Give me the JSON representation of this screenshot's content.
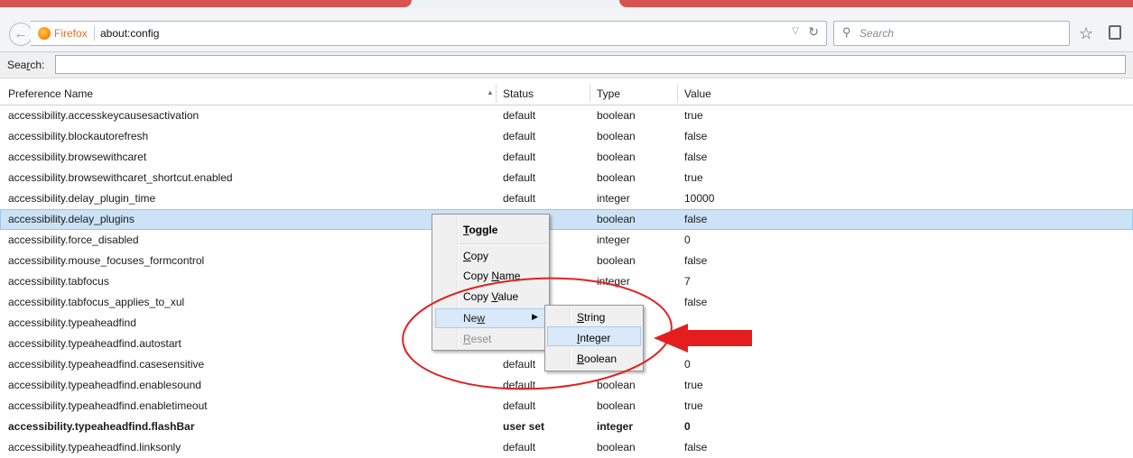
{
  "browser": {
    "identity_label": "Firefox",
    "url": "about:config",
    "search_placeholder": "Search"
  },
  "config": {
    "search_label": "Search:",
    "search_value": ""
  },
  "table": {
    "columns": [
      "Preference Name",
      "Status",
      "Type",
      "Value"
    ],
    "rows": [
      {
        "name": "accessibility.accesskeycausesactivation",
        "status": "default",
        "type": "boolean",
        "value": "true"
      },
      {
        "name": "accessibility.blockautorefresh",
        "status": "default",
        "type": "boolean",
        "value": "false"
      },
      {
        "name": "accessibility.browsewithcaret",
        "status": "default",
        "type": "boolean",
        "value": "false"
      },
      {
        "name": "accessibility.browsewithcaret_shortcut.enabled",
        "status": "default",
        "type": "boolean",
        "value": "true"
      },
      {
        "name": "accessibility.delay_plugin_time",
        "status": "default",
        "type": "integer",
        "value": "10000"
      },
      {
        "name": "accessibility.delay_plugins",
        "status": "",
        "type": "boolean",
        "value": "false",
        "selected": true
      },
      {
        "name": "accessibility.force_disabled",
        "status": "",
        "type": "integer",
        "value": "0"
      },
      {
        "name": "accessibility.mouse_focuses_formcontrol",
        "status": "",
        "type": "boolean",
        "value": "false"
      },
      {
        "name": "accessibility.tabfocus",
        "status": "",
        "type": "integer",
        "value": "7"
      },
      {
        "name": "accessibility.tabfocus_applies_to_xul",
        "status": "",
        "type": "",
        "value": "false"
      },
      {
        "name": "accessibility.typeaheadfind",
        "status": "",
        "type": "",
        "value": ""
      },
      {
        "name": "accessibility.typeaheadfind.autostart",
        "status": "",
        "type": "",
        "value": ""
      },
      {
        "name": "accessibility.typeaheadfind.casesensitive",
        "status": "default",
        "type": "",
        "value": "0"
      },
      {
        "name": "accessibility.typeaheadfind.enablesound",
        "status": "default",
        "type": "boolean",
        "value": "true"
      },
      {
        "name": "accessibility.typeaheadfind.enabletimeout",
        "status": "default",
        "type": "boolean",
        "value": "true"
      },
      {
        "name": "accessibility.typeaheadfind.flashBar",
        "status": "user set",
        "type": "integer",
        "value": "0",
        "userset": true
      },
      {
        "name": "accessibility.typeaheadfind.linksonly",
        "status": "default",
        "type": "boolean",
        "value": "false"
      }
    ]
  },
  "context_menu": {
    "toggle": {
      "key": "T",
      "rest": "oggle"
    },
    "copy": {
      "key": "C",
      "rest": "opy"
    },
    "copy_name": {
      "pre": "Copy ",
      "key": "N",
      "rest": "ame"
    },
    "copy_value": {
      "pre": "Copy ",
      "key": "V",
      "rest": "alue"
    },
    "new": {
      "pre": "Ne",
      "key": "w"
    },
    "reset": {
      "key": "R",
      "rest": "eset"
    }
  },
  "submenu": {
    "string": {
      "key": "S",
      "rest": "tring"
    },
    "integer": {
      "key": "I",
      "rest": "nteger"
    },
    "boolean": {
      "key": "B",
      "rest": "oolean"
    }
  },
  "annotation": {
    "circle_color": "#e02222",
    "arrow_color": "#e41e1e"
  }
}
